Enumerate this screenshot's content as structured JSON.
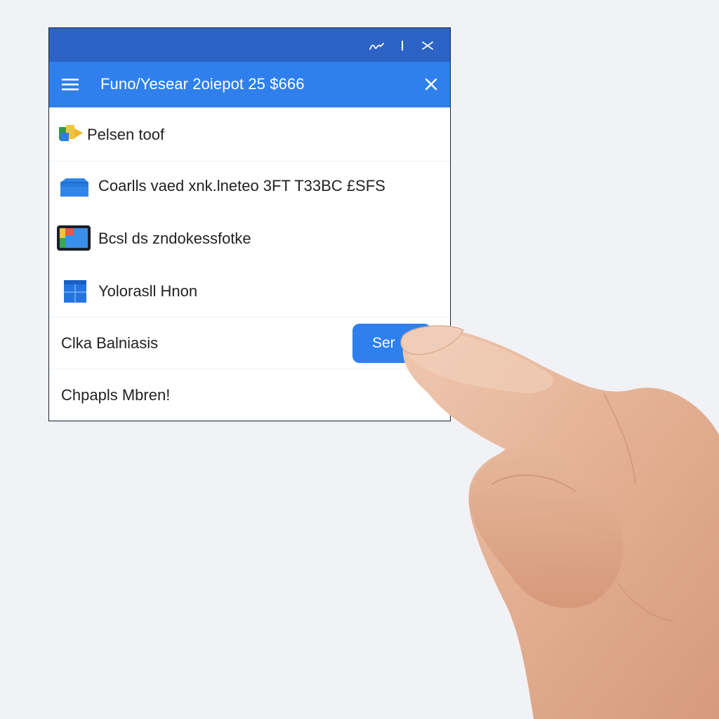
{
  "window": {
    "titlebar": {
      "controls": [
        {
          "name": "minimize",
          "icon": "minimize-icon"
        },
        {
          "name": "maximize",
          "icon": "maximize-icon"
        },
        {
          "name": "close",
          "icon": "close-icon"
        }
      ]
    },
    "appbar": {
      "title": "Funo/Yesear 2oiepot 25 $666",
      "menu_icon": "hamburger-menu-icon",
      "close_icon": "close-icon"
    },
    "rows": [
      {
        "label": "Pelsen toof",
        "icon": "folder-icon"
      },
      {
        "label": "Coarlls vaed xnk.lneteo 3FT T33BC £SFS",
        "icon": "cloud-icon"
      },
      {
        "label": "Bcsl ds zndokessfotke",
        "icon": "tablet-icon"
      },
      {
        "label": "Yolorasll Hnon",
        "icon": "window-icon"
      },
      {
        "label": "Clka Balniasis",
        "button_label": "Ser"
      },
      {
        "label": "Chpapls  Mbren!"
      }
    ]
  },
  "colors": {
    "titlebar": "#2c63c4",
    "appbar": "#2f80ed",
    "button": "#2f80ed",
    "background": "#f1f2f6"
  }
}
